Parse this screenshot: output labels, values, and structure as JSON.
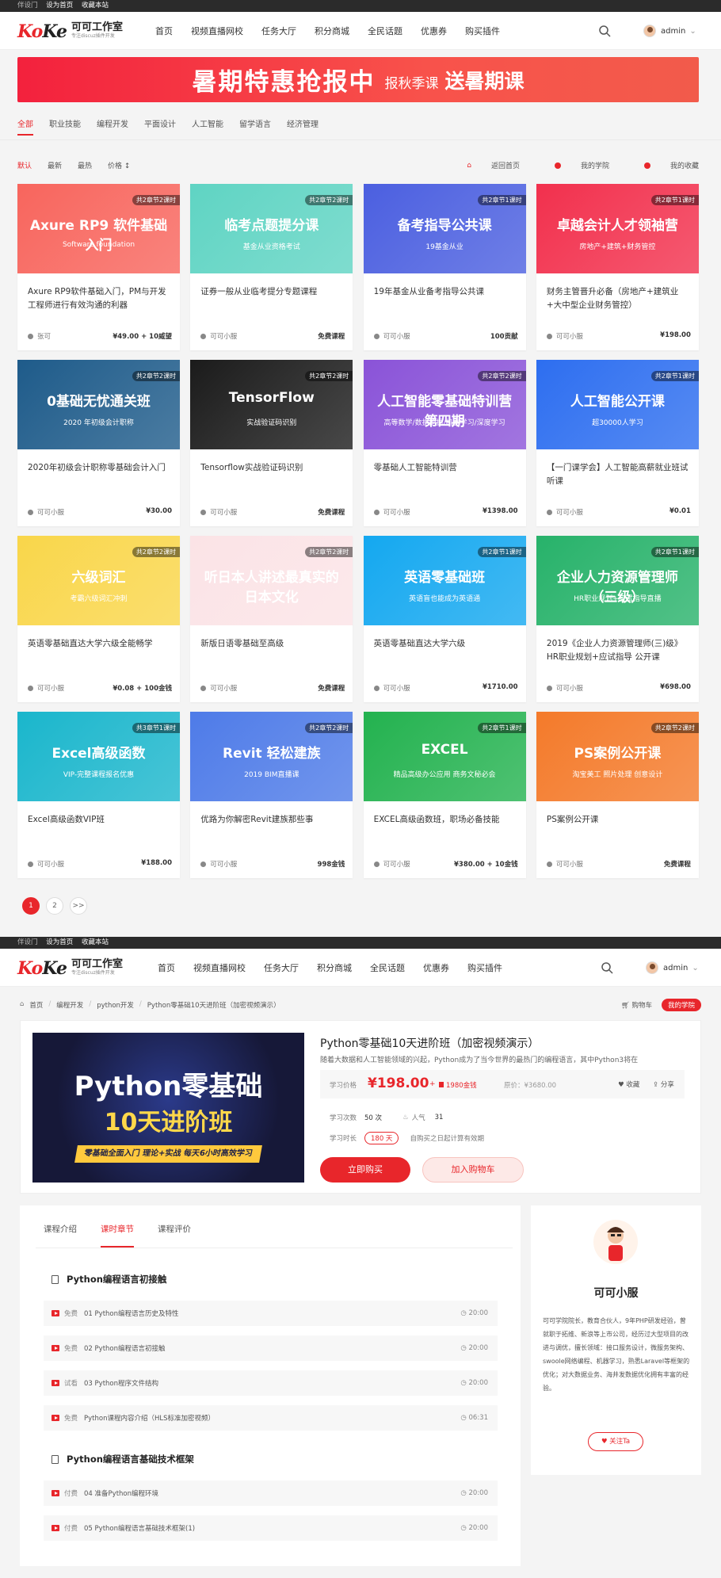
{
  "topbar": {
    "links": [
      "伴设门",
      "设为首页",
      "收藏本站"
    ]
  },
  "logo": {
    "brand_a": "Ko",
    "brand_b": "Ke",
    "name": "可可工作室",
    "tagline": "专注discuz插件开发"
  },
  "nav": [
    "首页",
    "视频直播网校",
    "任务大厅",
    "积分商城",
    "全民话题",
    "优惠券",
    "购买插件"
  ],
  "user": {
    "name": "admin"
  },
  "banner": {
    "main": "暑期特惠抢报中",
    "sub": "报秋季课",
    "tail": "送暑期课"
  },
  "categories": [
    "全部",
    "职业技能",
    "编程开发",
    "平面设计",
    "人工智能",
    "留学语言",
    "经济管理"
  ],
  "sorts": [
    "默认",
    "最新",
    "最热",
    "价格 ↕"
  ],
  "tools": [
    "返回首页",
    "我的学院",
    "我的收藏"
  ],
  "courses": [
    {
      "thumb": "Axure RP9 软件基础入门",
      "thumb_sub": "Software foundation",
      "chap": "共2章节2课时",
      "title": "Axure RP9软件基础入门，PM与开发工程师进行有效沟通的利器",
      "author": "张可",
      "price": "¥49.00 + 10威望",
      "bg": "#f8655d"
    },
    {
      "thumb": "临考点题提分课",
      "thumb_sub": "基金从业资格考试",
      "chap": "共2章节2课时",
      "title": "证券一般从业临考提分专题课程",
      "author": "可可小服",
      "price": "免费课程",
      "bg": "#5fd4c3"
    },
    {
      "thumb": "备考指导公共课",
      "thumb_sub": "19基金从业",
      "chap": "共2章节1课时",
      "title": "19年基金从业备考指导公共课",
      "author": "可可小服",
      "price": "100贡献",
      "bg": "#4b5fe0"
    },
    {
      "thumb": "卓越会计人才领袖营",
      "thumb_sub": "房地产+建筑+财务管控",
      "chap": "共2章节1课时",
      "title": "财务主管晋升必备（房地产+建筑业+大中型企业财务管控）",
      "author": "可可小服",
      "price": "¥198.00",
      "bg": "#f2304d"
    },
    {
      "thumb": "0基础无忧通关班",
      "thumb_sub": "2020 年初级会计职称",
      "chap": "共2章节2课时",
      "title": "2020年初级会计职称零基础会计入门",
      "author": "可可小服",
      "price": "¥30.00",
      "bg": "#1e5b8a"
    },
    {
      "thumb": "TensorFlow",
      "thumb_sub": "实战验证码识别",
      "chap": "共2章节2课时",
      "title": "Tensorflow实战验证码识别",
      "author": "可可小服",
      "price": "免费课程",
      "bg": "#1b1b1b"
    },
    {
      "thumb": "人工智能零基础特训营第四期",
      "thumb_sub": "高等数学/数据挖掘/机器学习/深度学习",
      "chap": "共2章节2课时",
      "title": "零基础人工智能特训营",
      "author": "可可小服",
      "price": "¥1398.00",
      "bg": "#8a53d8"
    },
    {
      "thumb": "人工智能公开课",
      "thumb_sub": "超30000人学习",
      "chap": "共2章节1课时",
      "title": "【一门课学会】人工智能高薪就业班试听课",
      "author": "可可小服",
      "price": "¥0.01",
      "bg": "#2d6ef0"
    },
    {
      "thumb": "六级词汇",
      "thumb_sub": "考霸六级词汇冲刺",
      "chap": "共2章节2课时",
      "title": "英语零基础直达大学六级全能畅学",
      "author": "可可小服",
      "price": "¥0.08 + 100金钱",
      "bg": "#f9d64a"
    },
    {
      "thumb": "听日本人讲述最真实的日本文化",
      "thumb_sub": "",
      "chap": "共2章节2课时",
      "title": "新版日语零基础至高级",
      "author": "可可小服",
      "price": "免费课程",
      "bg": "#fbe3e6"
    },
    {
      "thumb": "英语零基础班",
      "thumb_sub": "英语盲也能成为英语通",
      "chap": "共2章节1课时",
      "title": "英语零基础直达大学六级",
      "author": "可可小服",
      "price": "¥1710.00",
      "bg": "#14a8f0"
    },
    {
      "thumb": "企业人力资源管理师（三级）",
      "thumb_sub": "HR职业规划+应试指导直播",
      "chap": "共2章节1课时",
      "title": "2019《企业人力资源管理师(三)级》HR职业规划+应试指导 公开课",
      "author": "可可小服",
      "price": "¥698.00",
      "bg": "#27b26a"
    },
    {
      "thumb": "Excel高级函数",
      "thumb_sub": "VIP-完整课程报名优惠",
      "chap": "共3章节1课时",
      "title": "Excel高级函数VIP班",
      "author": "可可小服",
      "price": "¥188.00",
      "bg": "#1ab6cc"
    },
    {
      "thumb": "Revit 轻松建族",
      "thumb_sub": "2019 BIM直播课",
      "chap": "共2章节2课时",
      "title": "优路为你解密Revit建族那些事",
      "author": "可可小服",
      "price": "998金钱",
      "bg": "#4e7be8"
    },
    {
      "thumb": "EXCEL",
      "thumb_sub": "精品高级办公应用 商务文秘必会",
      "chap": "共2章节1课时",
      "title": "EXCEL高级函数班，职场必备技能",
      "author": "可可小服",
      "price": "¥380.00 + 10金钱",
      "bg": "#23b24f"
    },
    {
      "thumb": "PS案例公开课",
      "thumb_sub": "淘宝美工 照片处理 创意设计",
      "chap": "共2章节2课时",
      "title": "PS案例公开课",
      "author": "可可小服",
      "price": "免费课程",
      "bg": "#f47a2a"
    }
  ],
  "pager": [
    "1",
    "2",
    ">>"
  ],
  "breadcrumb": [
    "首页",
    "/",
    "编程开发",
    "/",
    "python开发",
    "/",
    "Python零基础10天进阶班（加密视频演示）"
  ],
  "crumb_right": {
    "cart": "购物车",
    "mine": "我的学院"
  },
  "course": {
    "img_line1": "Python零基础",
    "img_line2": "10天进阶班",
    "img_line3": "零基础全面入门 理论+实战 每天6小时高效学习",
    "title": "Python零基础10天进阶班（加密视频演示）",
    "desc": "随着大数据和人工智能领域的兴起，Python成为了当今世界的最热门的编程语言，其中Python3将在",
    "price_label": "学习价格",
    "price": "¥198.00",
    "plus": "+",
    "coin": "1980金钱",
    "orig": "原价：¥3680.00",
    "fav": "收藏",
    "share": "分享",
    "count_label": "学习次数",
    "count": "50 次",
    "pop_label": "人气",
    "pop": "31",
    "dur_label": "学习时长",
    "days": "180 天",
    "dur_note": "自购买之日起计算有效期",
    "buy": "立即购买",
    "add_cart": "加入购物车"
  },
  "tabs": [
    "课程介绍",
    "课时章节",
    "课程评价"
  ],
  "sections": [
    {
      "title": "Python编程语言初接触",
      "lessons": [
        {
          "tag": "免费",
          "name": "01 Python编程语言历史及特性",
          "dur": "20:00"
        },
        {
          "tag": "免费",
          "name": "02 Python编程语言初接触",
          "dur": "20:00"
        },
        {
          "tag": "试看",
          "name": "03 Python程序文件结构",
          "dur": "20:00"
        },
        {
          "tag": "免费",
          "name": "Python课程内容介绍（HLS标准加密视频）",
          "dur": "06:31"
        }
      ]
    },
    {
      "title": "Python编程语言基础技术框架",
      "lessons": [
        {
          "tag": "付费",
          "name": "04 准备Python编程环境",
          "dur": "20:00"
        },
        {
          "tag": "付费",
          "name": "05 Python编程语言基础技术框架(1)",
          "dur": "20:00"
        }
      ]
    }
  ],
  "teacher": {
    "name": "可可小服",
    "bio": "可可学院院长，教育合伙人，9年PHP研发经验，曾就职于拓维、新浪等上市公司，经历过大型项目的改进与调优，擅长领域：接口服务设计，微服务架构、swoole网络编程、机器学习，熟悉Laravel等框架的优化；对大数据业务、海井发数据优化拥有丰富的经验。",
    "follow": "♥ 关注Ta"
  }
}
